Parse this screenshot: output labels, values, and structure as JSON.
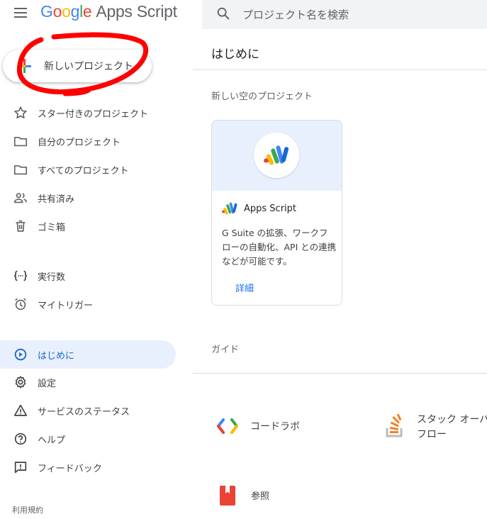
{
  "header": {
    "logo_letters": [
      "G",
      "o",
      "o",
      "g",
      "l",
      "e"
    ],
    "product": "Apps Script",
    "search_placeholder": "プロジェクト名を検索"
  },
  "sidebar": {
    "new_project_label": "新しいプロジェクト",
    "items": [
      {
        "label": "スター付きのプロジェクト",
        "icon": "star-icon"
      },
      {
        "label": "自分のプロジェクト",
        "icon": "folder-icon"
      },
      {
        "label": "すべてのプロジェクト",
        "icon": "folder-icon"
      },
      {
        "label": "共有済み",
        "icon": "people-icon"
      },
      {
        "label": "ゴミ箱",
        "icon": "trash-icon"
      },
      {
        "label": "実行数",
        "icon": "code-brackets-icon"
      },
      {
        "label": "マイトリガー",
        "icon": "alarm-icon"
      },
      {
        "label": "はじめに",
        "icon": "play-circle-icon",
        "active": true
      },
      {
        "label": "設定",
        "icon": "gear-icon"
      },
      {
        "label": "サービスのステータス",
        "icon": "warning-icon"
      },
      {
        "label": "ヘルプ",
        "icon": "help-icon"
      },
      {
        "label": "フィードバック",
        "icon": "feedback-icon"
      }
    ],
    "terms": "利用規約"
  },
  "main": {
    "title": "はじめに",
    "blank_section": "新しい空のプロジェクト",
    "card": {
      "title": "Apps Script",
      "description": "G Suite の拡張、ワークフローの自動化、API との連携などが可能です。",
      "link": "詳細"
    },
    "guide_section": "ガイド",
    "guides": [
      {
        "label": "コードラボ",
        "icon": "codelabs-icon"
      },
      {
        "label": "スタック オーバーフロー",
        "icon": "stack-overflow-icon",
        "line1": "スタック オーバ",
        "line2": "フロー"
      },
      {
        "label": "参照",
        "icon": "reference-book-icon"
      }
    ]
  },
  "colors": {
    "accent": "#1a73e8",
    "active_bg": "#e8f0fe",
    "annotation_red": "#ff0000"
  }
}
